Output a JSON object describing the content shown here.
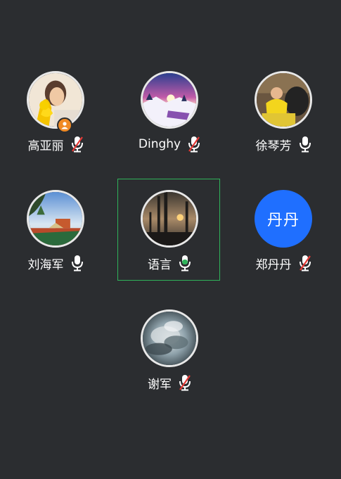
{
  "participants": [
    {
      "name": "高亚丽",
      "mic": "muted",
      "host": true,
      "avatar": "photo-girl-flower-icon"
    },
    {
      "name": "Dinghy",
      "mic": "muted",
      "host": false,
      "avatar": "photo-snow-sunset-icon"
    },
    {
      "name": "徐琴芳",
      "mic": "on",
      "host": false,
      "avatar": "photo-child-yellow-icon"
    },
    {
      "name": "刘海军",
      "mic": "on",
      "host": false,
      "avatar": "photo-park-sky-icon"
    },
    {
      "name": "语言",
      "mic": "speaking",
      "host": false,
      "avatar": "photo-industrial-sunset-icon"
    },
    {
      "name": "郑丹丹",
      "mic": "muted",
      "host": false,
      "avatar_text": "丹丹"
    },
    {
      "name": "谢军",
      "mic": "muted",
      "host": false,
      "avatar": "photo-storm-clouds-icon"
    }
  ],
  "colors": {
    "background": "#2b2d30",
    "speaking_frame": "#2fb35a",
    "mic_active": "#2fb35a",
    "mic_muted_slash": "#e53935",
    "text_avatar": "#1f6fff",
    "host_badge": "#f08a24"
  }
}
